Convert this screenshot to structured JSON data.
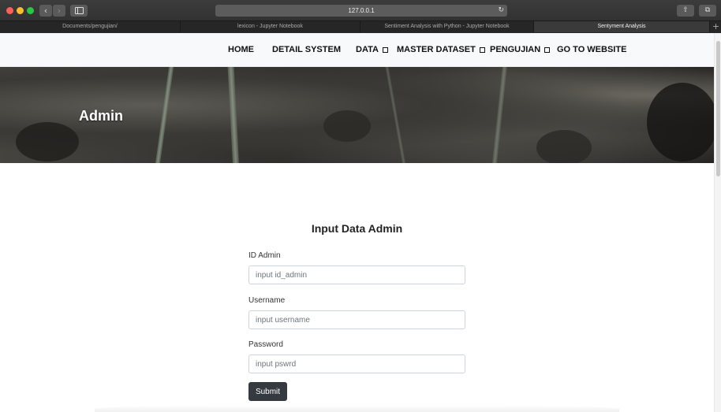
{
  "browser": {
    "url": "127.0.0.1",
    "tabs": [
      {
        "label": "Documents/pengujian/",
        "active": false
      },
      {
        "label": "lexicon - Jupyter Notebook",
        "active": false
      },
      {
        "label": "Sentiment Analysis with Python - Jupyter Notebook",
        "active": false
      },
      {
        "label": "Sentyment Analysis",
        "active": true
      }
    ],
    "icons": {
      "back": "‹",
      "forward": "›",
      "reload": "↻",
      "share": "⇧",
      "tabs": "⧉",
      "add_tab": "+"
    }
  },
  "site_nav": {
    "items": [
      {
        "label": "HOME",
        "has_dropdown": false
      },
      {
        "label": "DETAIL SYSTEM",
        "has_dropdown": false
      },
      {
        "label": "DATA",
        "has_dropdown": true
      },
      {
        "label": "MASTER DATASET",
        "has_dropdown": true
      },
      {
        "label": "PENGUJIAN",
        "has_dropdown": true
      },
      {
        "label": "GO TO WEBSITE",
        "has_dropdown": false
      }
    ]
  },
  "hero": {
    "title": "Admin"
  },
  "form": {
    "title": "Input Data Admin",
    "fields": [
      {
        "label": "ID Admin",
        "placeholder": "input id_admin",
        "value": ""
      },
      {
        "label": "Username",
        "placeholder": "input username",
        "value": ""
      },
      {
        "label": "Password",
        "placeholder": "input pswrd",
        "value": ""
      }
    ],
    "submit_label": "Submit"
  },
  "colors": {
    "nav_bg": "#f8f9fa",
    "button_dark": "#343a40",
    "traffic_red": "#fe5f57",
    "traffic_yellow": "#febc2e",
    "traffic_green": "#28c840"
  }
}
